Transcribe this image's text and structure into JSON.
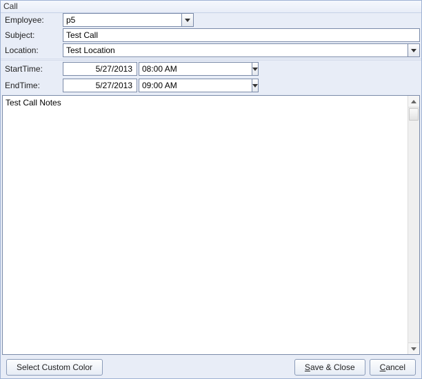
{
  "window": {
    "title": "Call"
  },
  "labels": {
    "employee": "Employee:",
    "subject": "Subject:",
    "location": "Location:",
    "start": "StartTime:",
    "end": "EndTime:"
  },
  "fields": {
    "employee": "p5",
    "subject": "Test Call",
    "location": "Test Location",
    "start_date": "5/27/2013",
    "start_time": "08:00 AM",
    "end_date": "5/27/2013",
    "end_time": "09:00 AM",
    "notes": "Test Call Notes"
  },
  "buttons": {
    "custom_color": "Select Custom Color",
    "save_close_pre": "",
    "save_close_accel": "S",
    "save_close_post": "ave & Close",
    "cancel_pre": "",
    "cancel_accel": "C",
    "cancel_post": "ancel"
  }
}
